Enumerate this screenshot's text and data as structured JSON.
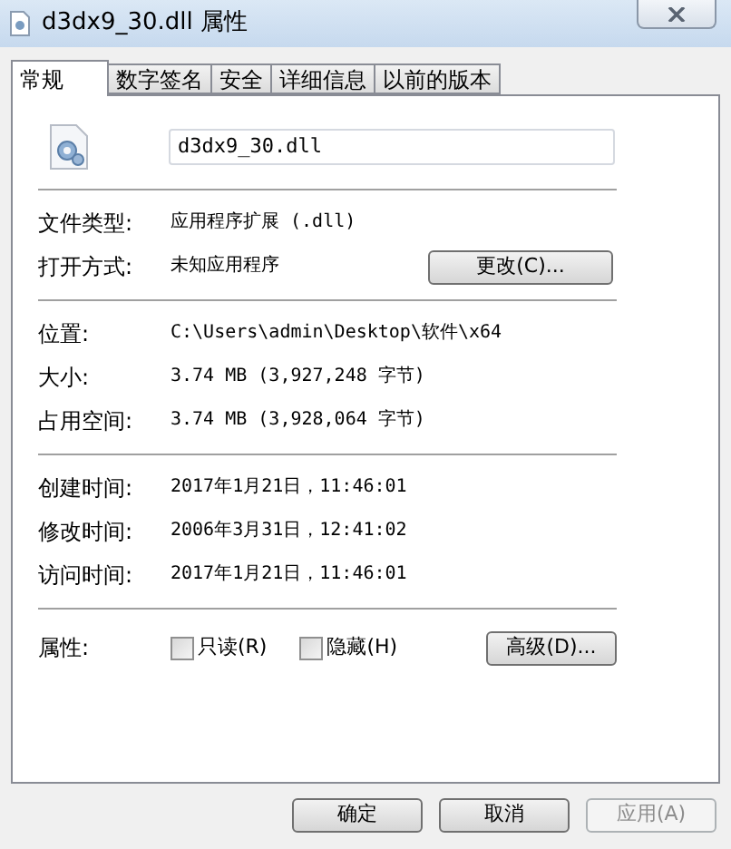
{
  "window": {
    "title": "d3dx9_30.dll 属性"
  },
  "tabs": [
    {
      "label": "常规",
      "selected": true
    },
    {
      "label": "数字签名",
      "selected": false
    },
    {
      "label": "安全",
      "selected": false
    },
    {
      "label": "详细信息",
      "selected": false
    },
    {
      "label": "以前的版本",
      "selected": false
    }
  ],
  "file_name": {
    "value": "d3dx9_30.dll"
  },
  "sections": [
    [
      {
        "label": "文件类型:",
        "value": "应用程序扩展 (.dll)"
      },
      {
        "label": "打开方式:",
        "value": "未知应用程序",
        "button": "更改(C)..."
      }
    ],
    [
      {
        "label": "位置:",
        "value": "C:\\Users\\admin\\Desktop\\软件\\x64"
      },
      {
        "label": "大小:",
        "value": "3.74 MB (3,927,248 字节)"
      },
      {
        "label": "占用空间:",
        "value": "3.74 MB (3,928,064 字节)"
      }
    ],
    [
      {
        "label": "创建时间:",
        "value": "2017年1月21日，11:46:01"
      },
      {
        "label": "修改时间:",
        "value": "2006年3月31日，12:41:02"
      },
      {
        "label": "访问时间:",
        "value": "2017年1月21日，11:46:01"
      }
    ]
  ],
  "attributes": {
    "label": "属性:",
    "checkboxes": [
      {
        "label": "只读(R)",
        "checked": false
      },
      {
        "label": "隐藏(H)",
        "checked": false
      }
    ],
    "button": "高级(D)..."
  },
  "buttons": [
    {
      "label": "确定",
      "disabled": false
    },
    {
      "label": "取消",
      "disabled": false
    },
    {
      "label": "应用(A)",
      "disabled": true
    }
  ]
}
